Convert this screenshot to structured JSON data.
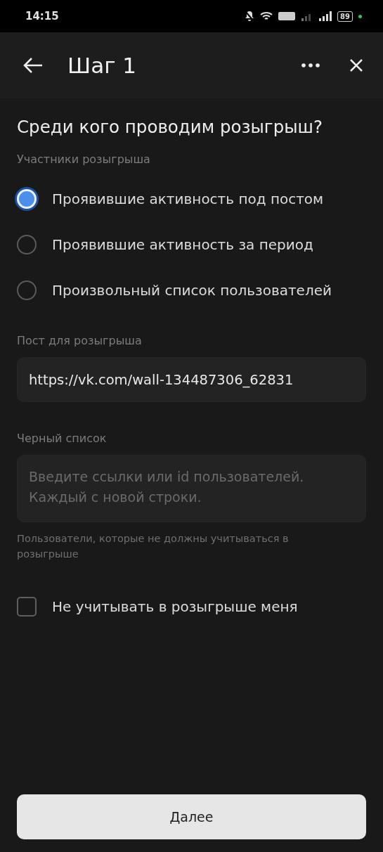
{
  "status_bar": {
    "time": "14:15",
    "battery": "89"
  },
  "header": {
    "title": "Шаг 1"
  },
  "question": "Среди кого проводим розыгрыш?",
  "participants": {
    "label": "Участники розыгрыша",
    "options": [
      {
        "label": "Проявившие активность под постом",
        "selected": true
      },
      {
        "label": "Проявившие активность за период",
        "selected": false
      },
      {
        "label": "Произвольный список пользователей",
        "selected": false
      }
    ]
  },
  "post": {
    "label": "Пост для розыгрыша",
    "value": "https://vk.com/wall-134487306_62831"
  },
  "blacklist": {
    "label": "Черный список",
    "placeholder": "Введите ссылки или id пользователей.\nКаждый с новой строки.",
    "hint": "Пользователи, которые не должны учитываться в розыгрыше"
  },
  "exclude_me": {
    "label": "Не учитывать в розыгрыше меня",
    "checked": false
  },
  "next_button": "Далее"
}
